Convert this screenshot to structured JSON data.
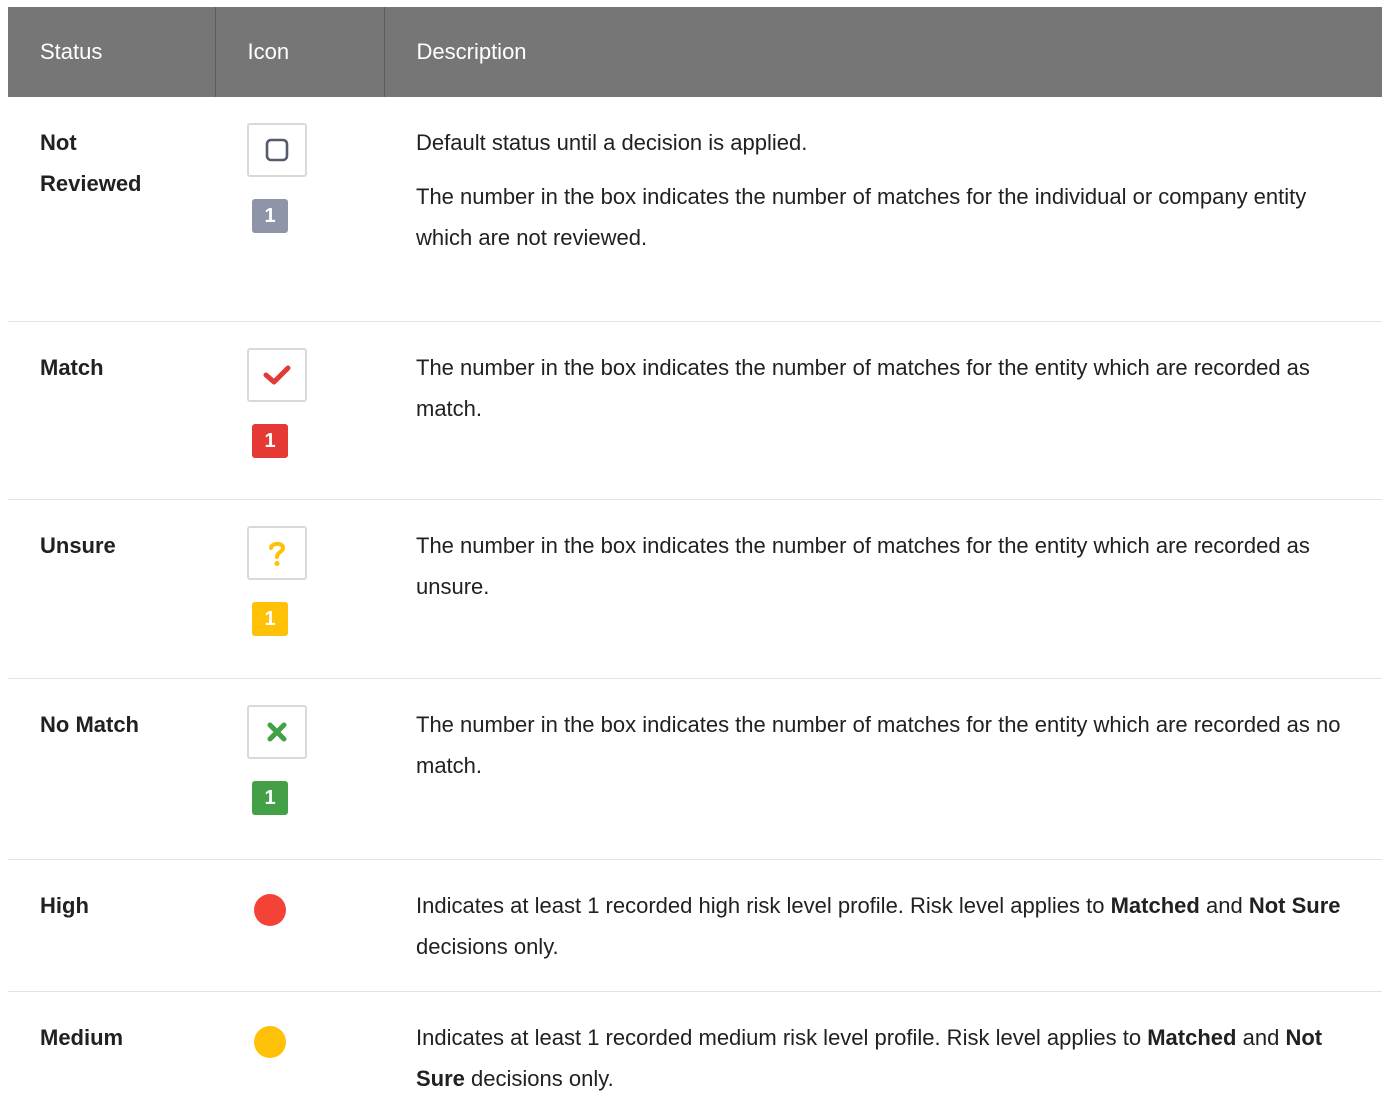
{
  "header": {
    "status": "Status",
    "icon": "Icon",
    "description": "Description"
  },
  "colors": {
    "header_bg": "#767676",
    "not_reviewed": "#8e95a8",
    "match": "#e53935",
    "unsure": "#ffc107",
    "no_match": "#43a047",
    "high": "#f44336",
    "medium": "#ffc107"
  },
  "rows": [
    {
      "status_line1": "Not",
      "status_line2": "Reviewed",
      "icon": "empty-checkbox-icon",
      "count": "1",
      "desc_p1": "Default status until a decision is applied.",
      "desc_p2": "The number in the box indicates the number of matches for the individual or company entity which are not reviewed."
    },
    {
      "status": "Match",
      "icon": "checkmark-icon",
      "count": "1",
      "desc": "The number in the box indicates the number of matches for the entity which are recorded as match."
    },
    {
      "status": "Unsure",
      "icon": "question-mark-icon",
      "count": "1",
      "desc": "The number in the box indicates the number of matches for the entity which are recorded as unsure."
    },
    {
      "status": "No Match",
      "icon": "cross-icon",
      "count": "1",
      "desc": "The number in the box indicates the number of matches for the entity which are recorded as no match."
    },
    {
      "status": "High",
      "icon": "red-dot-icon",
      "desc_a": "Indicates at least 1 recorded high risk level profile. Risk level applies to",
      "desc_b1": "Matched",
      "desc_c": "and",
      "desc_b2": "Not Sure",
      "desc_d": "decisions only."
    },
    {
      "status": "Medium",
      "icon": "yellow-dot-icon",
      "desc_a": "Indicates at least 1 recorded medium risk level profile. Risk level applies to",
      "desc_b1": "Matched",
      "desc_c": "and",
      "desc_b2": "Not Sure",
      "desc_d": "decisions only."
    }
  ]
}
